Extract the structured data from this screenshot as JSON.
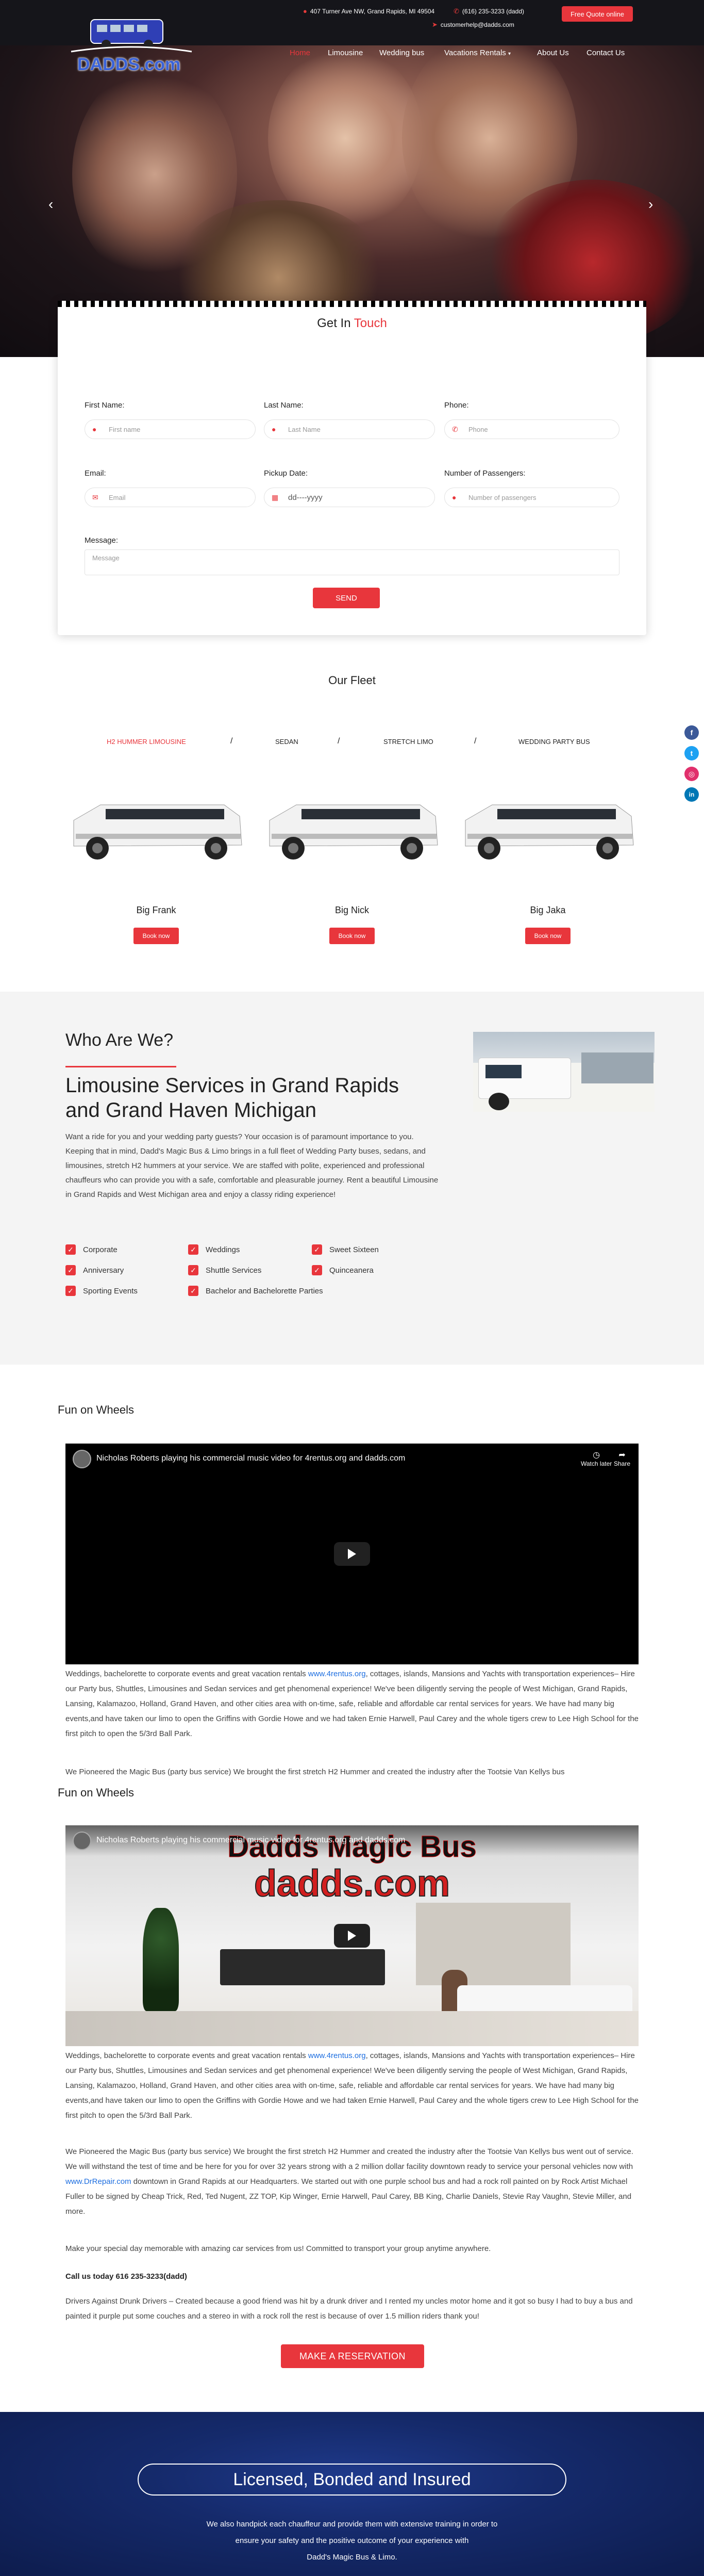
{
  "topbar": {
    "address": "407 Turner Ave NW, Grand Rapids, MI 49504",
    "phone": "(616) 235-3233 (dadd)",
    "email": "customerhelp@dadds.com",
    "quote_label": "Free Quote online"
  },
  "logo": {
    "text": "DADDS.com"
  },
  "nav": {
    "items": [
      {
        "label": "Home"
      },
      {
        "label": "Limousine"
      },
      {
        "label": "Wedding bus"
      },
      {
        "label": "Vacations Rentals"
      },
      {
        "label": "About Us"
      },
      {
        "label": "Contact Us"
      }
    ]
  },
  "hero": {
    "prev": "‹",
    "next": "›"
  },
  "contact": {
    "title": "Get In",
    "title_accent": "Touch",
    "first_name_label": "First Name:",
    "first_name_placeholder": "First name",
    "last_name_label": "Last Name:",
    "last_name_placeholder": "Last Name",
    "phone_label": "Phone:",
    "phone_placeholder": "Phone",
    "email_label": "Email:",
    "email_placeholder": "Email",
    "pickup_label": "Pickup Date:",
    "pickup_placeholder": "dd----yyyy",
    "passengers_label": "Number of Passengers:",
    "passengers_placeholder": "Number of passengers",
    "message_label": "Message:",
    "message_placeholder": "Message",
    "send_label": "SEND"
  },
  "fleet": {
    "title": "Our Fleet",
    "tabs": [
      "H2 HUMMER LIMOUSINE",
      "SEDAN",
      "STRETCH LIMO",
      "WEDDING PARTY BUS"
    ],
    "cars": [
      {
        "name": "Big Frank",
        "book": "Book now"
      },
      {
        "name": "Big Nick",
        "book": "Book now"
      },
      {
        "name": "Big Jaka",
        "book": "Book now"
      }
    ]
  },
  "social": {
    "facebook": "f",
    "twitter": "t",
    "instagram": "◎",
    "linkedin": "in"
  },
  "who": {
    "title": "Who Are We?",
    "heading": "Limousine Services in Grand Rapids and Grand Haven Michigan",
    "text": "Want a ride for you and your wedding party guests? Your occasion is of paramount importance to you. Keeping that in mind, Dadd's Magic Bus & Limo brings in a full fleet of Wedding Party buses, sedans, and limousines, stretch H2 hummers at your service. We are staffed with polite, experienced and professional chauffeurs who can provide you with a safe, comfortable and pleasurable journey. Rent a beautiful Limousine in Grand Rapids and West Michigan area and enjoy a classy riding experience!",
    "services": [
      "Corporate",
      "Weddings",
      "Sweet Sixteen",
      "Anniversary",
      "Shuttle Services",
      "Quinceanera",
      "Sporting Events",
      "Bachelor and Bachelorette Parties"
    ]
  },
  "video1": {
    "section_title": "Fun on Wheels",
    "title": "Nicholas Roberts playing his commercial music video for 4rentus.org and dadds.com",
    "watch_later": "Watch later",
    "share": "Share",
    "para1_a": "Weddings, bachelorette to corporate events and great vacation rentals ",
    "para1_link": "www.4rentus.org",
    "para1_b": ", cottages, islands, Mansions and Yachts with transportation experiences– Hire our Party bus, Shuttles, Limousines and Sedan services and get phenomenal experience! We've been diligently serving the people of West Michigan, Grand Rapids, Lansing, Kalamazoo, Holland, Grand Haven, and other cities area with on-time, safe, reliable and affordable car rental services for years. We have had many big events,and have taken our limo to open the Griffins with Gordie Howe and we had taken Ernie Harwell, Paul Carey and the whole tigers crew to Lee High School for the first pitch to open the 5/3rd Ball Park.",
    "para2": "We Pioneered the Magic Bus (party bus service) We brought the first stretch H2 Hummer and created the industry after the Tootsie Van Kellys bus"
  },
  "video2": {
    "section_title": "Fun on Wheels",
    "title": "Nicholas Roberts playing his commercial music video for 4rentus.org and dadds.com",
    "overlay_line1": "Dadds Magic Bus",
    "overlay_line2": "dadds.com",
    "para1_a": "Weddings, bachelorette to corporate events and great vacation rentals ",
    "para1_link": "www.4rentus.org",
    "para1_b": ", cottages, islands, Mansions and Yachts with transportation experiences– Hire our Party bus, Shuttles, Limousines and Sedan services and get phenomenal experience! We've been diligently serving the people of West Michigan, Grand Rapids, Lansing, Kalamazoo, Holland, Grand Haven, and other cities area with on-time, safe, reliable and affordable car rental services for years. We have had many big events,and have taken our limo to open the Griffins with Gordie Howe and we had taken Ernie Harwell, Paul Carey and the whole tigers crew to Lee High School for the first pitch to open the 5/3rd Ball Park.",
    "para2_a": "We Pioneered the Magic Bus (party bus service) We brought the first stretch H2 Hummer and created the industry after the Tootsie Van Kellys bus went out of service. We will withstand the test of time and be here for you for over 32 years strong with a 2 million dollar facility downtown ready to service your personal vehicles now with ",
    "para2_link": "www.DrRepair.com",
    "para2_b": " downtown in Grand Rapids at our Headquarters. We started out with one purple school bus and had a rock roll painted on by Rock Artist Michael Fuller to be signed by Cheap Trick, Red, Ted Nugent, ZZ TOP, Kip Winger, Ernie Harwell, Paul Carey, BB King, Charlie Daniels, Stevie Ray Vaughn, Stevie Miller, and more.",
    "para3": "Make your special day memorable with amazing car services from us! Committed to transport your group anytime anywhere.",
    "call": "Call us today 616 235-3233(dadd)",
    "para4": "Drivers Against Drunk Drivers – Created because a good friend was hit by a drunk driver and I rented my uncles motor home and it got so busy I had to buy a bus and painted it purple put some couches and a stereo in with a rock roll the rest is because of over 1.5 million riders thank you!",
    "reservation": "MAKE A RESERVATION"
  },
  "bottom": {
    "title": "Licensed, Bonded and Insured",
    "line1": "We also handpick each chauffeur and provide them with extensive training in order to",
    "line2": "ensure your safety and the positive outcome of your experience with",
    "line3": "Dadd's Magic Bus & Limo."
  }
}
